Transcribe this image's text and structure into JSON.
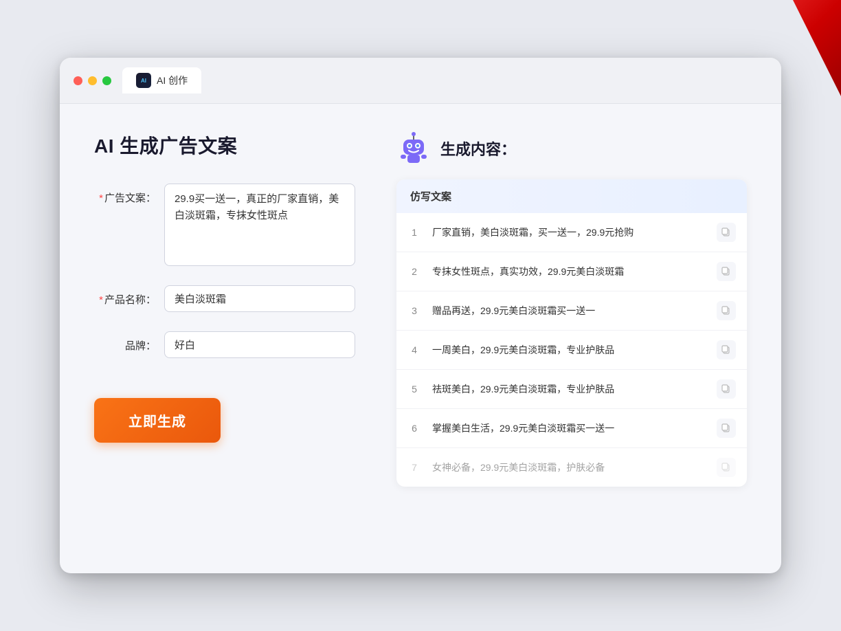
{
  "window": {
    "tab_icon_label": "AI",
    "tab_title": "AI 创作",
    "traffic_lights": [
      "red",
      "yellow",
      "green"
    ]
  },
  "page": {
    "title": "AI 生成广告文案",
    "result_title": "生成内容："
  },
  "form": {
    "ad_copy_label": "广告文案：",
    "ad_copy_required": true,
    "ad_copy_value": "29.9买一送一，真正的厂家直销，美白淡斑霜，专抹女性斑点",
    "product_name_label": "产品名称：",
    "product_name_required": true,
    "product_name_value": "美白淡斑霜",
    "brand_label": "品牌：",
    "brand_required": false,
    "brand_value": "好白",
    "generate_button": "立即生成"
  },
  "results": {
    "table_header": "仿写文案",
    "items": [
      {
        "num": "1",
        "text": "厂家直销，美白淡斑霜，买一送一，29.9元抢购",
        "faded": false
      },
      {
        "num": "2",
        "text": "专抹女性斑点，真实功效，29.9元美白淡斑霜",
        "faded": false
      },
      {
        "num": "3",
        "text": "赠品再送，29.9元美白淡斑霜买一送一",
        "faded": false
      },
      {
        "num": "4",
        "text": "一周美白，29.9元美白淡斑霜，专业护肤品",
        "faded": false
      },
      {
        "num": "5",
        "text": "祛斑美白，29.9元美白淡斑霜，专业护肤品",
        "faded": false
      },
      {
        "num": "6",
        "text": "掌握美白生活，29.9元美白淡斑霜买一送一",
        "faded": false
      },
      {
        "num": "7",
        "text": "女神必备，29.9元美白淡斑霜，护肤必备",
        "faded": true
      }
    ]
  },
  "colors": {
    "accent_orange": "#f97316",
    "accent_blue": "#5b8af0",
    "required_red": "#ff4444"
  }
}
